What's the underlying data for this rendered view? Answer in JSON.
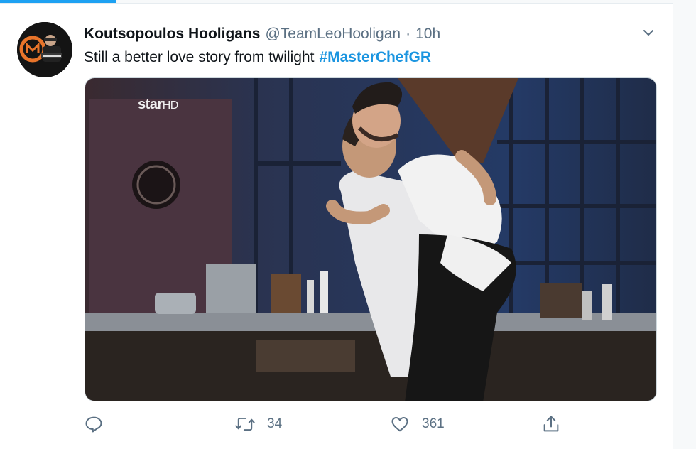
{
  "tweet": {
    "author_name": "Koutsopoulos Hooligans",
    "handle": "@TeamLeoHooligan",
    "separator": "·",
    "time": "10h",
    "text": "Still a better love story from twilight",
    "hashtag": "#MasterChefGR",
    "media": {
      "channel_logo": "star",
      "channel_logo_suffix": "HD"
    },
    "actions": {
      "reply_icon": "reply-icon",
      "retweet_icon": "retweet-icon",
      "retweet_count": "34",
      "like_icon": "heart-icon",
      "like_count": "361",
      "share_icon": "share-icon"
    }
  },
  "colors": {
    "accent": "#1da1f2",
    "hashtag": "#1b95e0",
    "secondary_text": "#5b7083",
    "primary_text": "#0f1419"
  }
}
